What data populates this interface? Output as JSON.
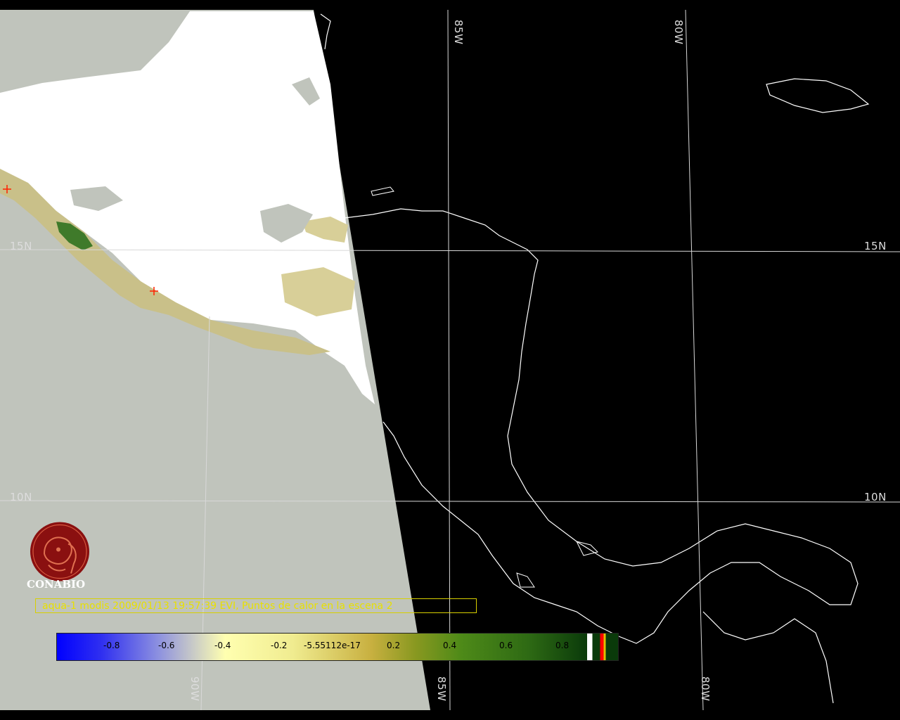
{
  "grid_labels": {
    "lat_15": "15N",
    "lat_10": "10N",
    "lon_85": "85W",
    "lon_80": "80W",
    "lon_90": "90W"
  },
  "logo": {
    "text": "CONABIO",
    "icon": "conabio-macaw-logo-icon"
  },
  "caption": "aqua-1 modis 2009/01/13 19:57:39 EVI, Puntos de calor en la escena 2",
  "colorbar": {
    "ticks": [
      "-0.8",
      "-0.6",
      "-0.4",
      "-0.2",
      "-5.55112e-17",
      "0.2",
      "0.4",
      "0.6",
      "0.8"
    ],
    "colors": {
      "low": "#0000ff",
      "mid": "#ffffb0",
      "high": "#0a3a0a",
      "land_mask": "#c0c4bc",
      "cloud": "#ffffff",
      "fire": "#ff0000"
    }
  }
}
